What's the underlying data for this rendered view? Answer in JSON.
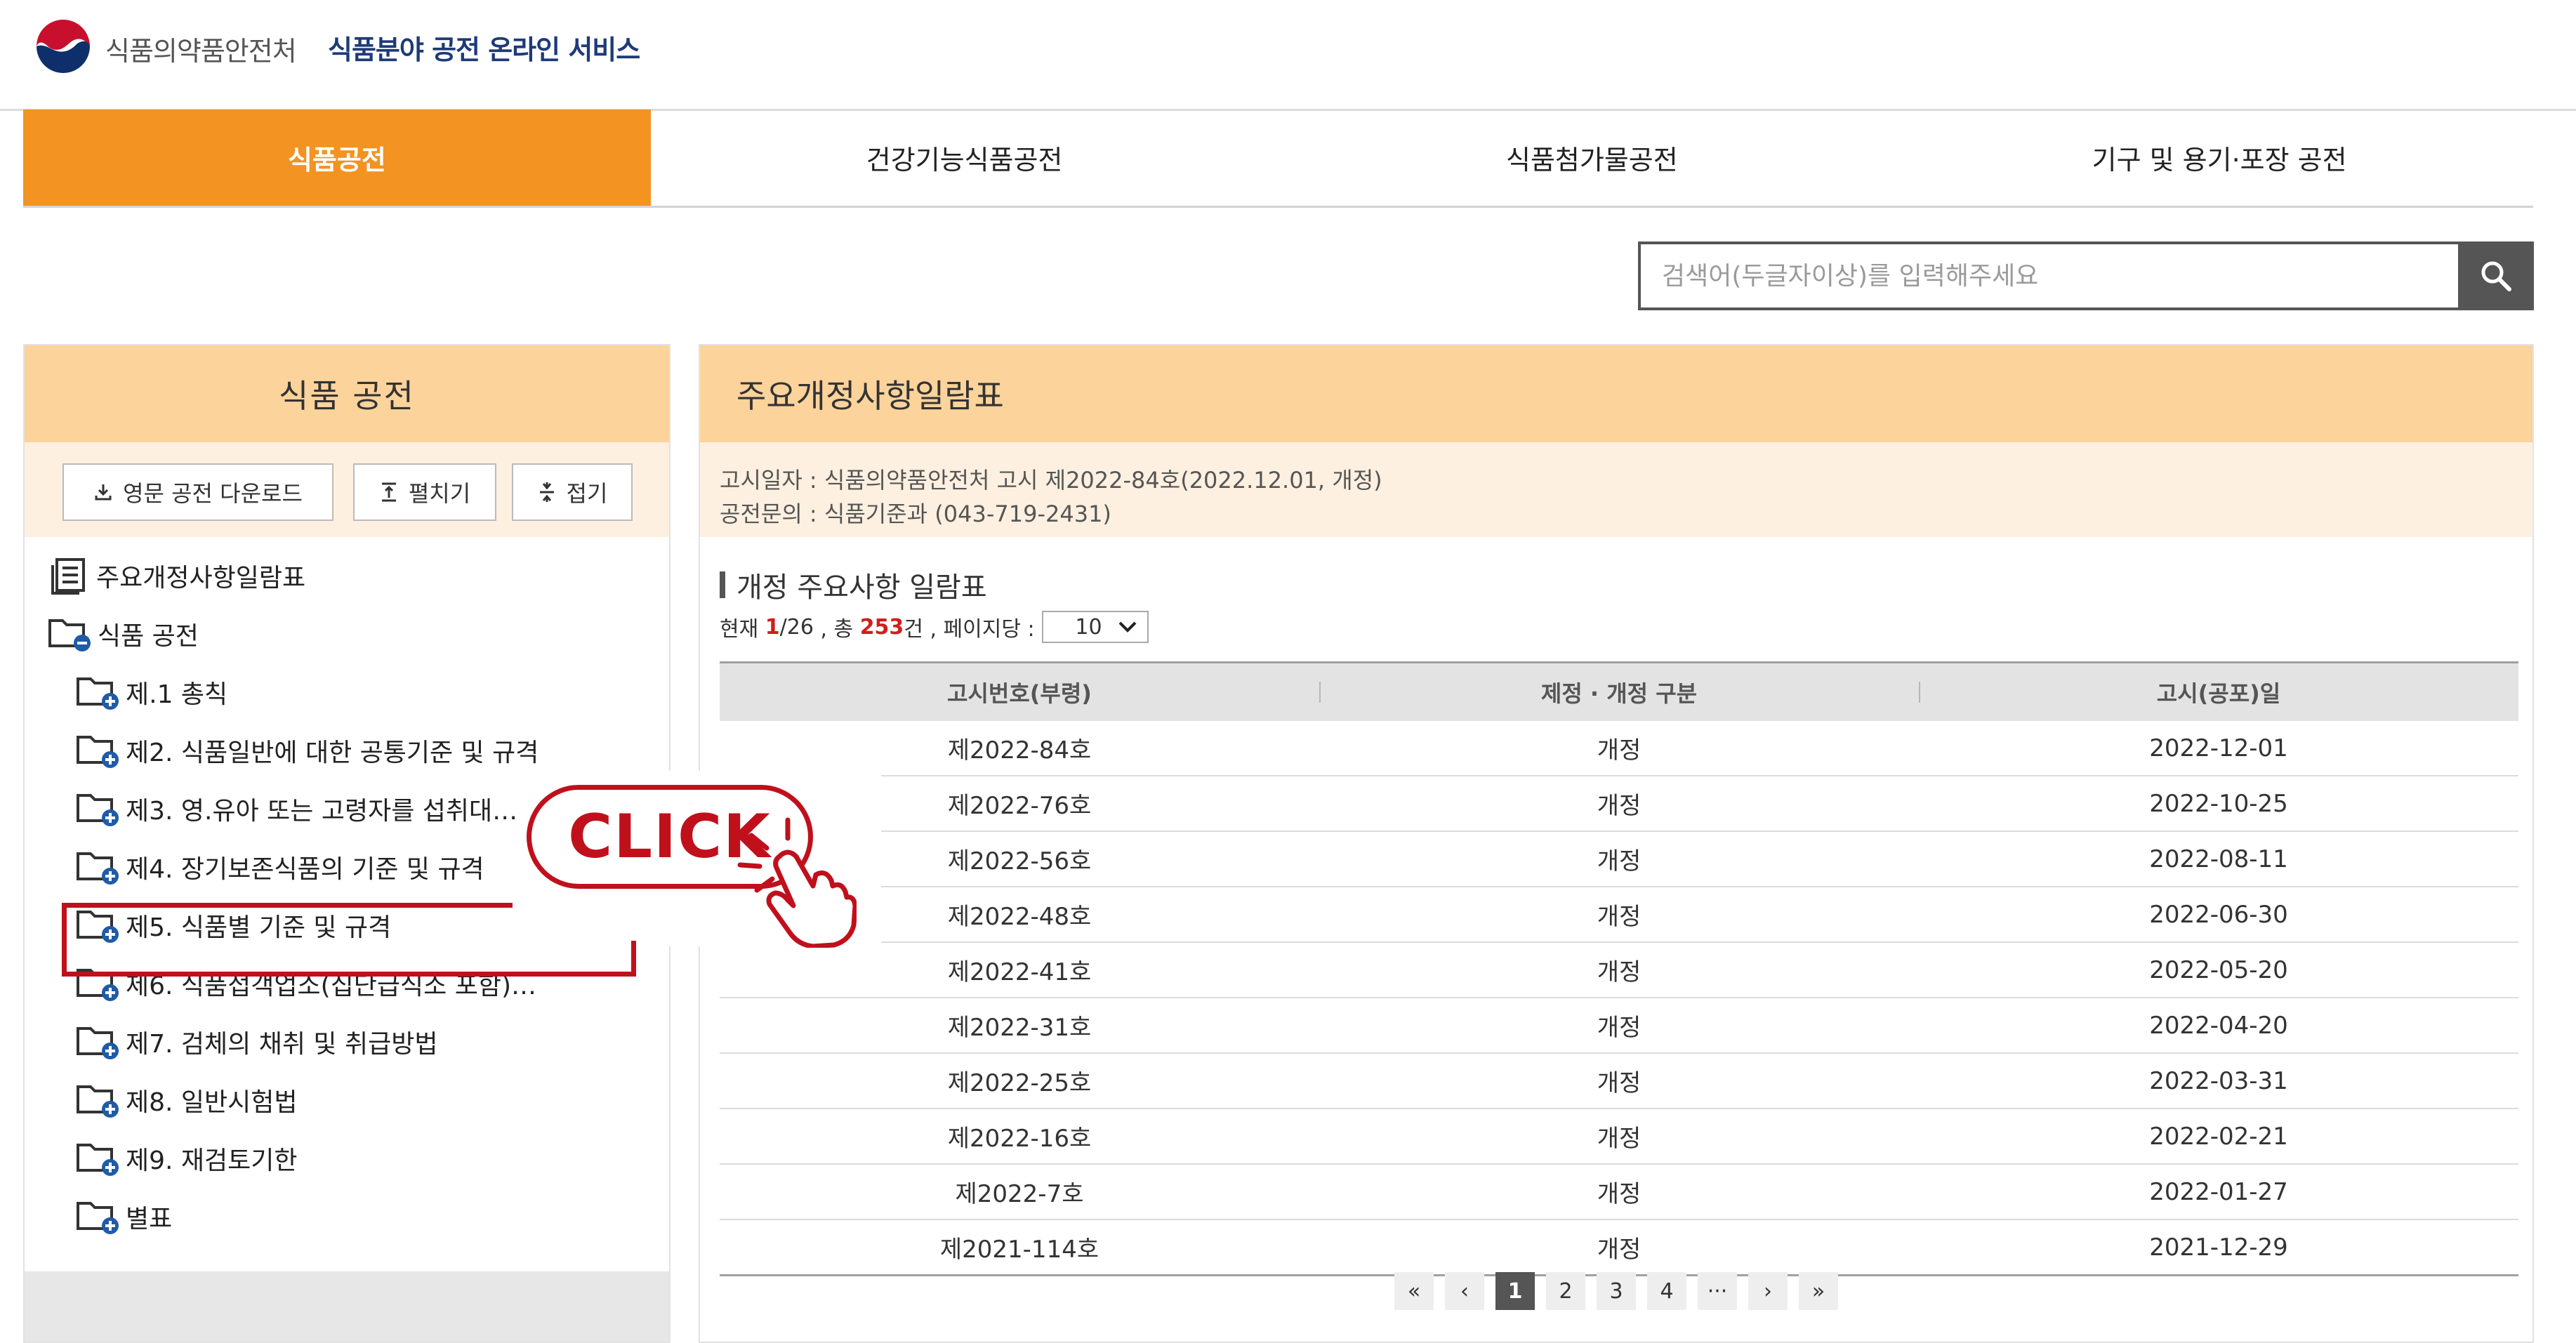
{
  "header": {
    "org_name": "식품의약품안전처",
    "service_name": "식품분야 공전 온라인 서비스"
  },
  "nav": {
    "tabs": [
      {
        "label": "식품공전",
        "active": true
      },
      {
        "label": "건강기능식품공전",
        "active": false
      },
      {
        "label": "식품첨가물공전",
        "active": false
      },
      {
        "label": "기구 및 용기·포장 공전",
        "active": false
      }
    ]
  },
  "search": {
    "placeholder": "검색어(두글자이상)를 입력해주세요",
    "icon": "search-icon"
  },
  "left_panel": {
    "title": "식품 공전",
    "buttons": {
      "download": "영문 공전 다운로드",
      "expand": "펼치기",
      "collapse": "접기"
    },
    "tree": [
      {
        "label": "주요개정사항일람표",
        "icon": "document-list-icon",
        "level": 0
      },
      {
        "label": "식품 공전",
        "icon": "folder-minus-icon",
        "level": 0
      },
      {
        "label": "제.1 총칙",
        "icon": "folder-plus-icon",
        "level": 1
      },
      {
        "label": "제2. 식품일반에 대한 공통기준 및 규격",
        "icon": "folder-plus-icon",
        "level": 1
      },
      {
        "label": "제3. 영.유아 또는 고령자를 섭취대…",
        "icon": "folder-plus-icon",
        "level": 1
      },
      {
        "label": "제4. 장기보존식품의 기준 및 규격",
        "icon": "folder-plus-icon",
        "level": 1
      },
      {
        "label": "제5. 식품별 기준 및 규격",
        "icon": "folder-plus-icon",
        "level": 1
      },
      {
        "label": "제6. 식품접객업소(집단급식소 포함)…",
        "icon": "folder-plus-icon",
        "level": 1
      },
      {
        "label": "제7. 검체의 채취 및 취급방법",
        "icon": "folder-plus-icon",
        "level": 1
      },
      {
        "label": "제8. 일반시험법",
        "icon": "folder-plus-icon",
        "level": 1
      },
      {
        "label": "제9. 재검토기한",
        "icon": "folder-plus-icon",
        "level": 1
      },
      {
        "label": "별표",
        "icon": "folder-plus-icon",
        "level": 1
      }
    ]
  },
  "main": {
    "title": "주요개정사항일람표",
    "info": {
      "notice_label": "고시일자 :",
      "notice_value": "식품의약품안전처 고시 제2022-84호(2022.12.01, 개정)",
      "contact_label": "공전문의 :",
      "contact_value": "식품기준과 (043-719-2431)"
    },
    "subtitle": "개정 주요사항 일람표",
    "count": {
      "prefix": "현재",
      "current_page": "1",
      "total_pages": "/26",
      "total_prefix": ", 총",
      "total": "253",
      "total_suffix": "건 , 페이지당 :",
      "per_page": "10"
    },
    "table": {
      "headers": [
        "고시번호(부령)",
        "제정 · 개정 구분",
        "고시(공포)일"
      ],
      "rows": [
        [
          "제2022-84호",
          "개정",
          "2022-12-01"
        ],
        [
          "제2022-76호",
          "개정",
          "2022-10-25"
        ],
        [
          "제2022-56호",
          "개정",
          "2022-08-11"
        ],
        [
          "제2022-48호",
          "개정",
          "2022-06-30"
        ],
        [
          "제2022-41호",
          "개정",
          "2022-05-20"
        ],
        [
          "제2022-31호",
          "개정",
          "2022-04-20"
        ],
        [
          "제2022-25호",
          "개정",
          "2022-03-31"
        ],
        [
          "제2022-16호",
          "개정",
          "2022-02-21"
        ],
        [
          "제2022-7호",
          "개정",
          "2022-01-27"
        ],
        [
          "제2021-114호",
          "개정",
          "2021-12-29"
        ]
      ]
    },
    "pagination": {
      "first": "«",
      "prev": "‹",
      "pages": [
        "1",
        "2",
        "3",
        "4"
      ],
      "active": "1",
      "ellipsis": "···",
      "next": "›",
      "last": "»"
    }
  },
  "annotation": {
    "click_label": "CLICK",
    "color": "#c0101c"
  },
  "colors": {
    "accent": "#f39322",
    "panel_header": "#fcd39b",
    "panel_sub": "#fdf0e0",
    "brand_text": "#1e3a78",
    "highlight": "#c0101c"
  }
}
